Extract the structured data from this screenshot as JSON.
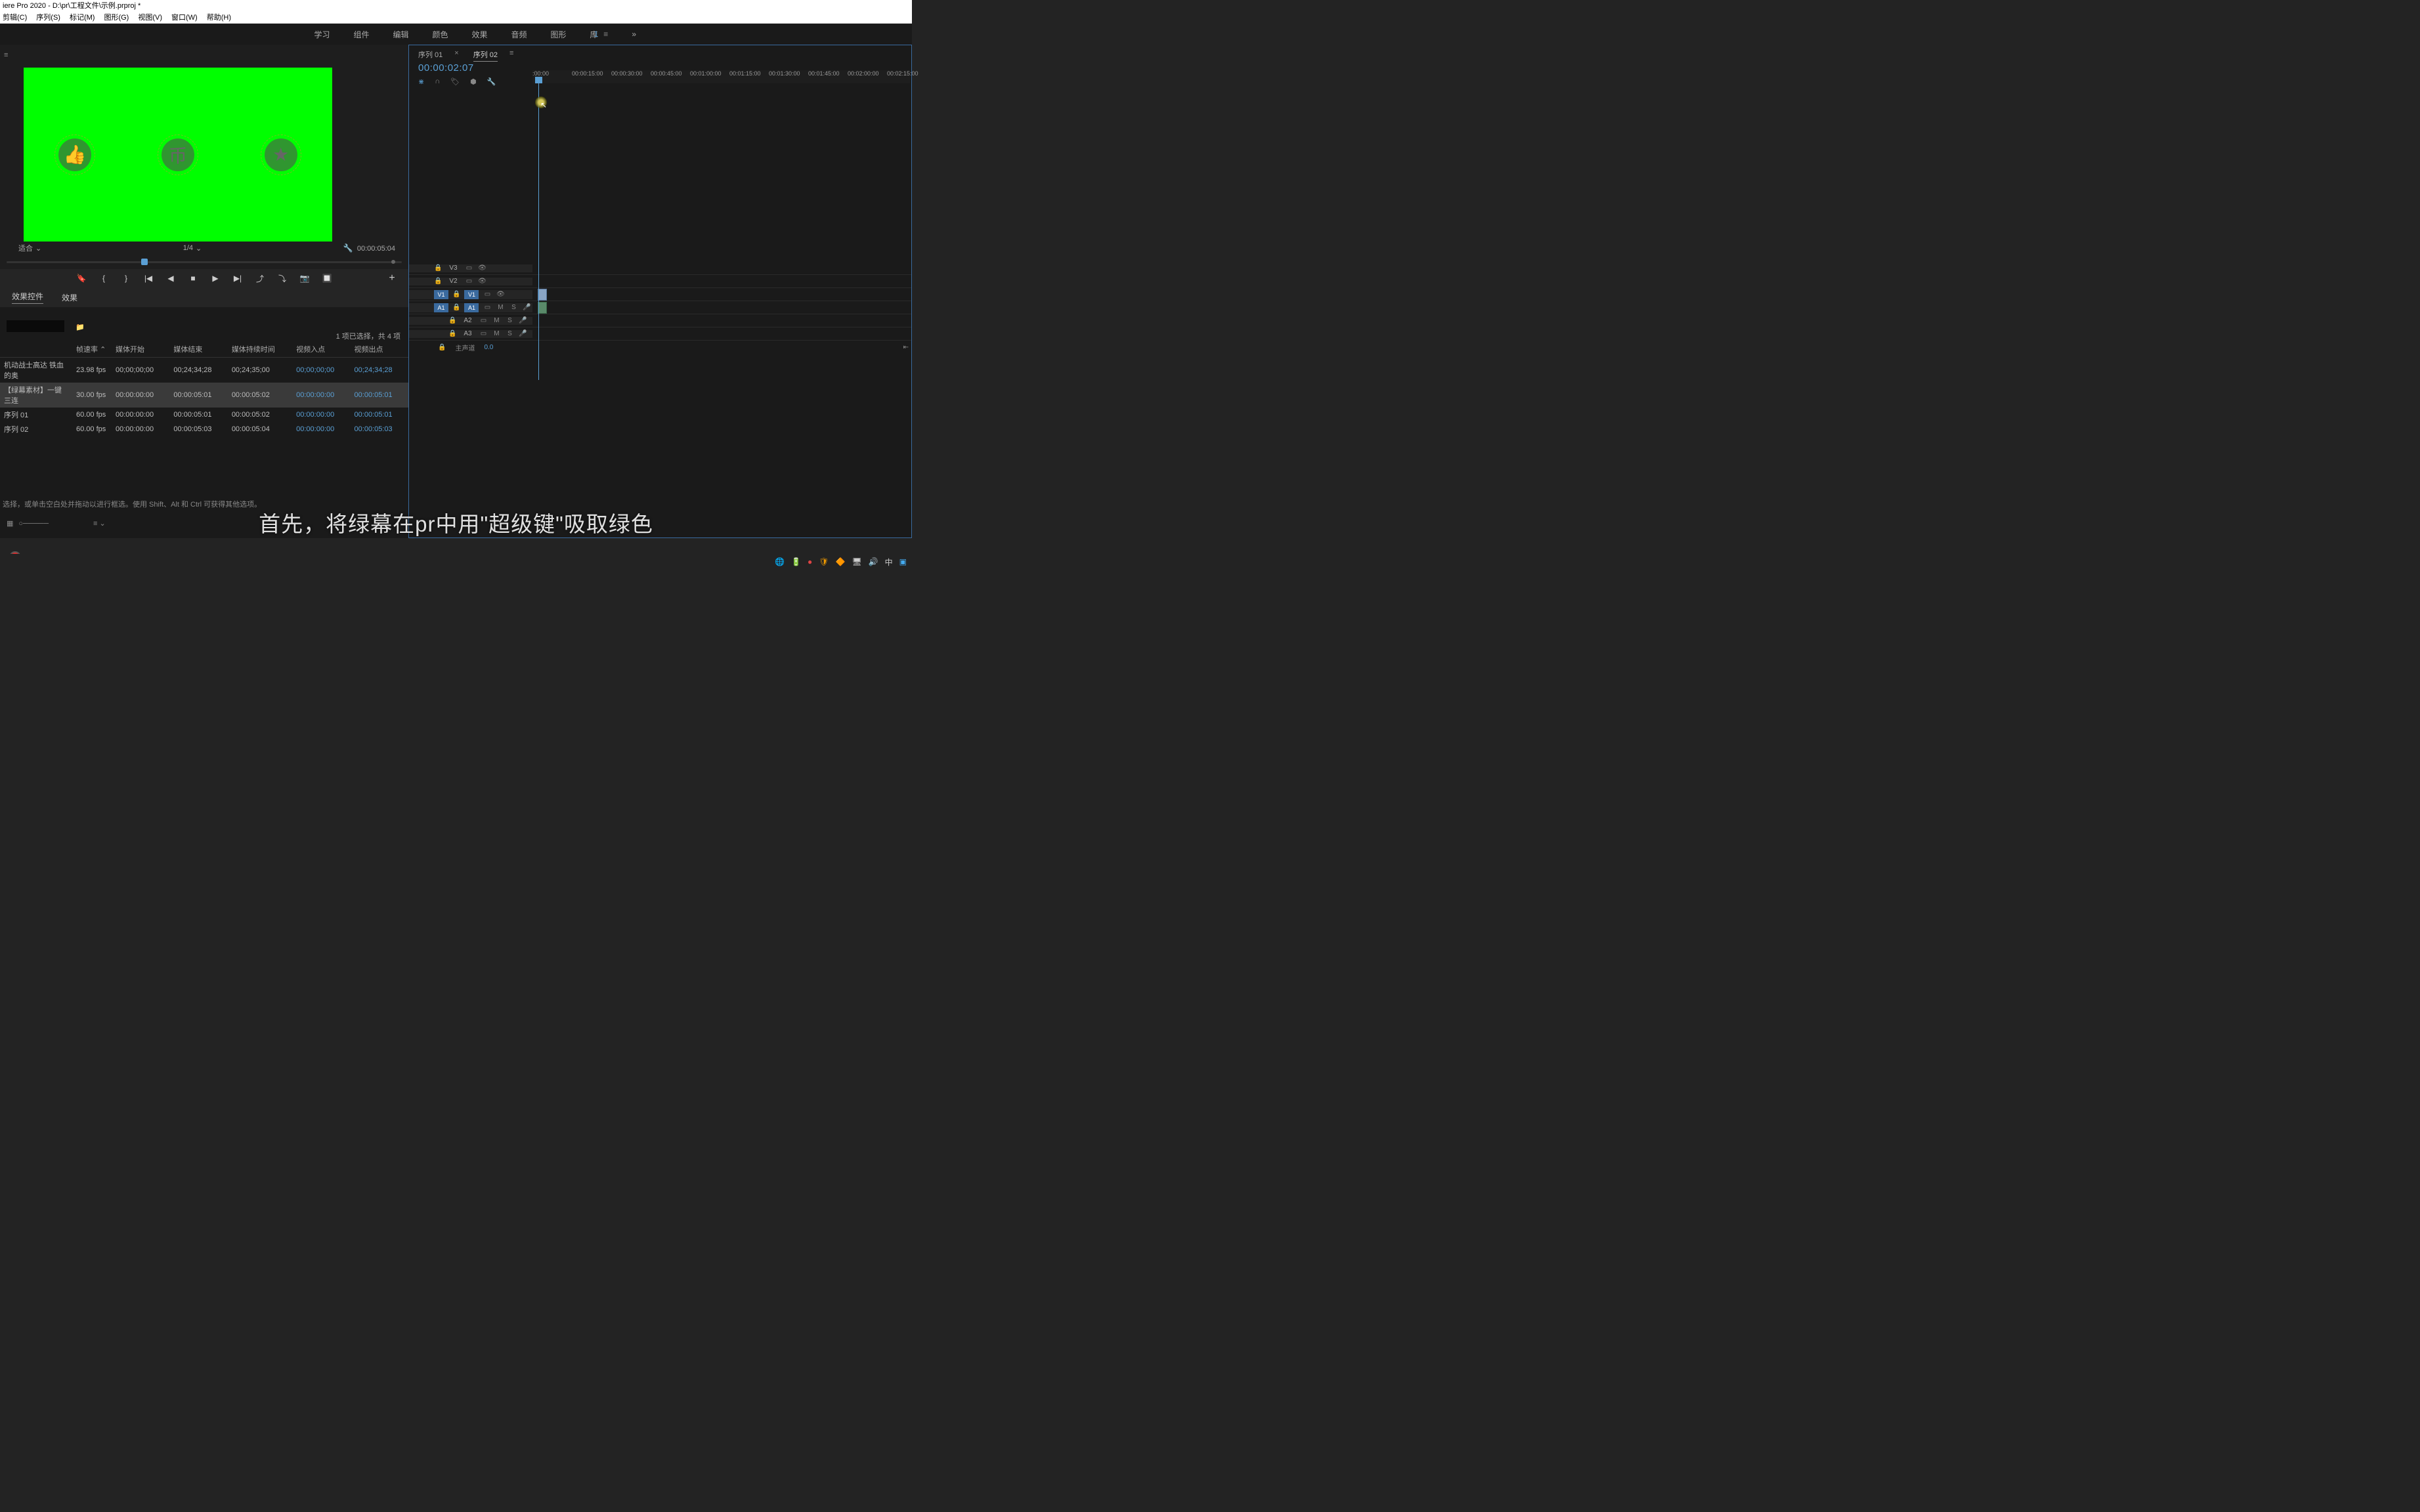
{
  "titlebar": "iere Pro 2020 - D:\\pr\\工程文件\\示例.prproj *",
  "menu": [
    "剪辑(C)",
    "序列(S)",
    "标记(M)",
    "图形(G)",
    "视图(V)",
    "窗口(W)",
    "帮助(H)"
  ],
  "workspace": {
    "items": [
      "学习",
      "组件",
      "编辑",
      "颜色",
      "效果",
      "音频",
      "图形",
      "库"
    ],
    "pager": "1",
    "more": "»"
  },
  "monitor": {
    "fit": "适合",
    "res": "1/4",
    "duration": "00:00:05:04"
  },
  "transport_icons": [
    "🔖",
    "{",
    "}",
    "|◀",
    "◀",
    "■",
    "▶",
    "▶|",
    "⤴",
    "⤵",
    "📷",
    "🔲"
  ],
  "effectTabs": {
    "t1": "效果控件",
    "t2": "效果"
  },
  "project": {
    "status": "1 项已选择，共 4 项",
    "cols": [
      "",
      "帧速率",
      "媒体开始",
      "媒体结束",
      "媒体持续时间",
      "视频入点",
      "视频出点"
    ],
    "rows": [
      {
        "name": "机动战士高达 铁血的奥",
        "fps": "23.98 fps",
        "ms": "00;00;00;00",
        "me": "00;24;34;28",
        "md": "00;24;35;00",
        "vi": "00;00;00;00",
        "vo": "00;24;34;28",
        "sel": false
      },
      {
        "name": "【绿幕素材】一键三连",
        "fps": "30.00 fps",
        "ms": "00:00:00:00",
        "me": "00:00:05:01",
        "md": "00:00:05:02",
        "vi": "00:00:00:00",
        "vo": "00:00:05:01",
        "sel": true
      },
      {
        "name": "序列 01",
        "fps": "60.00 fps",
        "ms": "00:00:00:00",
        "me": "00:00:05:01",
        "md": "00:00:05:02",
        "vi": "00:00:00:00",
        "vo": "00:00:05:01",
        "sel": false
      },
      {
        "name": "序列 02",
        "fps": "60.00 fps",
        "ms": "00:00:00:00",
        "me": "00:00:05:03",
        "md": "00:00:05:04",
        "vi": "00:00:00:00",
        "vo": "00:00:05:03",
        "sel": false
      }
    ],
    "hint": "选择，或单击空白处并拖动以进行框选。使用 Shift、Alt 和 Ctrl 可获得其他选项。"
  },
  "timeline": {
    "tabs": [
      "序列 01",
      "序列 02"
    ],
    "active_tab": 1,
    "timecode": "00:00:02:07",
    "ruler": [
      ":00:00",
      "00:00:15:00",
      "00:00:30:00",
      "00:00:45:00",
      "00:01:00:00",
      "00:01:15:00",
      "00:01:30:00",
      "00:01:45:00",
      "00:02:00:00",
      "00:02:15:00"
    ],
    "vtracks": [
      "V3",
      "V2",
      "V1"
    ],
    "atracks": [
      "A1",
      "A2",
      "A3"
    ],
    "master": "主声道",
    "master_val": "0.0",
    "mute": "M",
    "solo": "S"
  },
  "subtitle": "首先，将绿幕在pr中用\"超级键\"吸取绿色",
  "tray": {
    "ime": "中",
    "clock": ""
  }
}
